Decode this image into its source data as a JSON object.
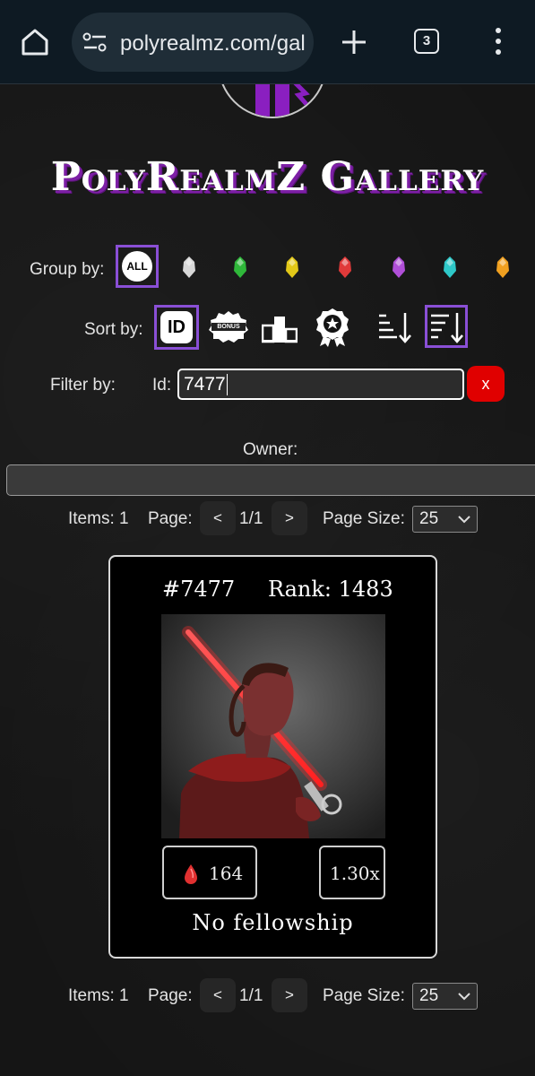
{
  "browser": {
    "url": "polyrealmz.com/gallery",
    "tab_count": "3"
  },
  "header": {
    "title": "PolyRealmZ Gallery"
  },
  "group_by": {
    "label": "Group by:",
    "all_label": "ALL",
    "options": [
      {
        "name": "white-gem-icon",
        "color": "#d8d8d8"
      },
      {
        "name": "green-gem-icon",
        "color": "#2fb83a"
      },
      {
        "name": "yellow-gem-icon",
        "color": "#e2c818"
      },
      {
        "name": "red-gem-icon",
        "color": "#e03a3a"
      },
      {
        "name": "purple-gem-icon",
        "color": "#b04fd8"
      },
      {
        "name": "teal-gem-icon",
        "color": "#2ec8c8"
      },
      {
        "name": "orange-gem-icon",
        "color": "#f0a020"
      }
    ]
  },
  "sort_by": {
    "label": "Sort by:",
    "id_label": "ID",
    "bonus_label": "BONUS"
  },
  "filter": {
    "label": "Filter by:",
    "id_label": "Id:",
    "id_value": "7477",
    "clear_label": "x",
    "owner_label": "Owner:",
    "owner_value": ""
  },
  "pagination": {
    "items_label": "Items: 1",
    "page_label": "Page:",
    "prev": "<",
    "next": ">",
    "page_value": "1/1",
    "page_size_label": "Page Size:",
    "page_size_value": "25"
  },
  "card": {
    "id": "#7477",
    "rank": "Rank: 1483",
    "power": "164",
    "multiplier": "1.30x",
    "fellowship": "No fellowship"
  },
  "colors": {
    "accent": "#8a4fd6",
    "clear_button": "#e00000",
    "title_shadow": "#7d1fa6"
  }
}
